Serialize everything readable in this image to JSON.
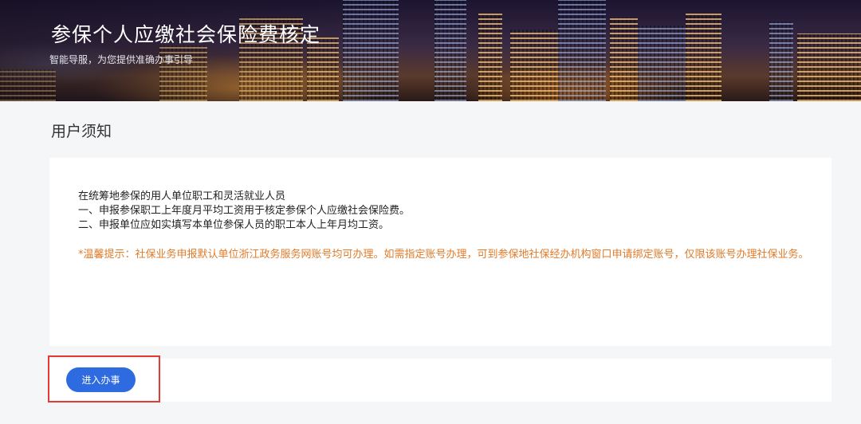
{
  "banner": {
    "title": "参保个人应缴社会保险费核定",
    "subtitle": "智能导服，为您提供准确办事引导"
  },
  "notice": {
    "heading": "用户须知",
    "lines": [
      "在统筹地参保的用人单位职工和灵活就业人员",
      "一、申报参保职工上年度月平均工资用于核定参保个人应缴社会保险费。",
      "二、申报单位应如实填写本单位参保人员的职工本人上年月均工资。"
    ],
    "tip": "*温馨提示：社保业务申报默认单位浙江政务服务网账号均可办理。如需指定账号办理，可到参保地社保经办机构窗口申请绑定账号，仅限该账号办理社保业务。",
    "tip_color": "#e07b2a"
  },
  "action": {
    "enter_label": "进入办事",
    "button_color": "#2f6be0",
    "highlight_color": "#e53935"
  }
}
